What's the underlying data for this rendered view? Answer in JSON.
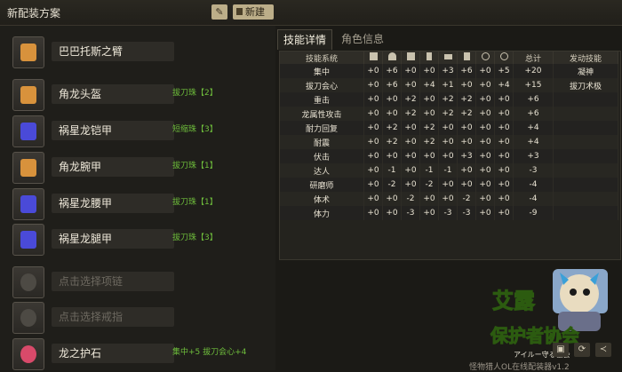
{
  "header": {
    "title": "新配装方案",
    "edit_icon": "pencil-icon",
    "new_button_label": "新建"
  },
  "equipment": [
    {
      "name": "巴巴托斯之臂",
      "note": "",
      "icon": "weapon-icon",
      "color": "#d8923c"
    },
    {
      "name": "角龙头盔",
      "note": "拔刀珠【2】",
      "icon": "helmet-icon",
      "color": "#d8923c"
    },
    {
      "name": "祸星龙铠甲",
      "note": "短缩珠【3】",
      "icon": "chest-icon",
      "color": "#4a4ad8"
    },
    {
      "name": "角龙腕甲",
      "note": "拔刀珠【1】",
      "icon": "arm-icon",
      "color": "#d8923c"
    },
    {
      "name": "祸星龙腰甲",
      "note": "拔刀珠【1】",
      "icon": "waist-icon",
      "color": "#4a4ad8"
    },
    {
      "name": "祸星龙腿甲",
      "note": "拔刀珠【3】",
      "icon": "leg-icon",
      "color": "#4a4ad8"
    },
    {
      "name": "点击选择项链",
      "note": "",
      "icon": "necklace-icon",
      "color": "#6a6760"
    },
    {
      "name": "点击选择戒指",
      "note": "",
      "icon": "ring-icon",
      "color": "#6a6760"
    },
    {
      "name": "龙之护石",
      "note": "集中+5  拔刀会心+4",
      "icon": "charm-icon",
      "color": "#d84a6a"
    }
  ],
  "tabs": {
    "active": "技能详情",
    "inactive": "角色信息"
  },
  "table": {
    "col_first": "技能系统",
    "col_total": "总计",
    "col_skill": "发动技能",
    "part_icons": [
      "weapon-icon",
      "helmet-icon",
      "chest-icon",
      "arm-icon",
      "waist-icon",
      "leg-icon",
      "necklace-icon",
      "ring-icon",
      "charm-icon"
    ],
    "rows": [
      {
        "name": "集中",
        "vals": [
          "+0",
          "+6",
          "+0",
          "+0",
          "+3",
          "+6",
          "+0",
          "+5"
        ],
        "total": "+20",
        "skill": "凝神"
      },
      {
        "name": "拔刀会心",
        "vals": [
          "+0",
          "+6",
          "+0",
          "+4",
          "+1",
          "+0",
          "+0",
          "+4"
        ],
        "total": "+15",
        "skill": "拔刀术极"
      },
      {
        "name": "重击",
        "vals": [
          "+0",
          "+0",
          "+2",
          "+0",
          "+2",
          "+2",
          "+0",
          "+0"
        ],
        "total": "+6",
        "skill": ""
      },
      {
        "name": "龙属性攻击",
        "vals": [
          "+0",
          "+0",
          "+2",
          "+0",
          "+2",
          "+2",
          "+0",
          "+0"
        ],
        "total": "+6",
        "skill": ""
      },
      {
        "name": "耐力回复",
        "vals": [
          "+0",
          "+2",
          "+0",
          "+2",
          "+0",
          "+0",
          "+0",
          "+0"
        ],
        "total": "+4",
        "skill": ""
      },
      {
        "name": "耐震",
        "vals": [
          "+0",
          "+2",
          "+0",
          "+2",
          "+0",
          "+0",
          "+0",
          "+0"
        ],
        "total": "+4",
        "skill": ""
      },
      {
        "name": "伏击",
        "vals": [
          "+0",
          "+0",
          "+0",
          "+0",
          "+0",
          "+3",
          "+0",
          "+0"
        ],
        "total": "+3",
        "skill": ""
      },
      {
        "name": "达人",
        "vals": [
          "+0",
          "-1",
          "+0",
          "-1",
          "-1",
          "+0",
          "+0",
          "+0"
        ],
        "total": "-3",
        "skill": ""
      },
      {
        "name": "研磨师",
        "vals": [
          "+0",
          "-2",
          "+0",
          "-2",
          "+0",
          "+0",
          "+0",
          "+0"
        ],
        "total": "-4",
        "skill": ""
      },
      {
        "name": "体术",
        "vals": [
          "+0",
          "+0",
          "-2",
          "+0",
          "+0",
          "-2",
          "+0",
          "+0"
        ],
        "total": "-4",
        "skill": ""
      },
      {
        "name": "体力",
        "vals": [
          "+0",
          "+0",
          "-3",
          "+0",
          "-3",
          "-3",
          "+0",
          "+0"
        ],
        "total": "-9",
        "skill": ""
      }
    ]
  },
  "logo": {
    "line1": "艾露",
    "line2": "保护者协会",
    "line3": "アイルー守る協会"
  },
  "bottom_buttons": [
    "save-icon",
    "refresh-icon",
    "share-icon"
  ],
  "footer": "怪物猎人OL在线配装器v1.2"
}
